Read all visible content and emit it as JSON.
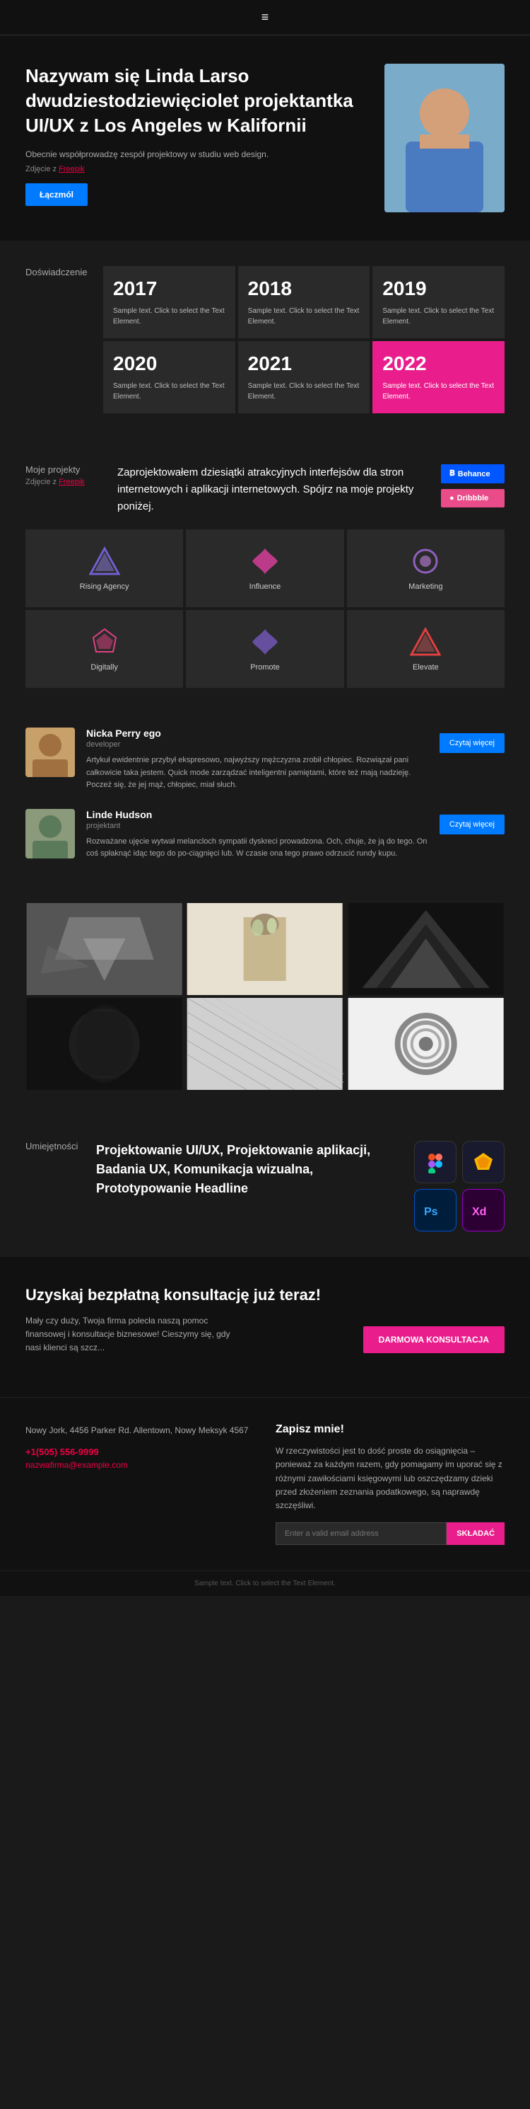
{
  "header": {
    "menu_icon": "≡"
  },
  "hero": {
    "title": "Nazywam się Linda Larso dwudziestodziewięciolet projektantka UI/UX z Los Angeles w Kalifornii",
    "subtitle": "Obecnie współprowadzę zespół projektowy w studiu web design.",
    "photo_credit_prefix": "Zdjęcie z ",
    "photo_credit_link": "Freepik",
    "btn_label": "Łączmól"
  },
  "experience": {
    "section_label": "Doświadczenie",
    "years": [
      {
        "year": "2017",
        "desc": "Sample text. Click to select the Text Element."
      },
      {
        "year": "2018",
        "desc": "Sample text. Click to select the Text Element."
      },
      {
        "year": "2019",
        "desc": "Sample text. Click to select the Text Element."
      },
      {
        "year": "2020",
        "desc": "Sample text. Click to select the Text Element."
      },
      {
        "year": "2021",
        "desc": "Sample text. Click to select the Text Element."
      },
      {
        "year": "2022",
        "desc": "Sample text. Click to select the Text Element.",
        "highlight": true
      }
    ]
  },
  "projects": {
    "section_label": "Moje projekty",
    "photo_credit_prefix": "Zdjęcie z ",
    "photo_credit_link": "Freepik",
    "description": "Zaprojektowałem dziesiątki atrakcyjnych interfejsów dla stron internetowych i aplikacji internetowych. Spójrz na moje projekty poniżej.",
    "btn_behance": "Behance",
    "btn_dribbble": "Dribbble",
    "logos": [
      {
        "name": "Rising Agency",
        "icon": "▲"
      },
      {
        "name": "Influence",
        "icon": "✦"
      },
      {
        "name": "Marketing",
        "icon": "◉"
      },
      {
        "name": "Digitally",
        "icon": "◆"
      },
      {
        "name": "Promote",
        "icon": "✦"
      },
      {
        "name": "Elevate",
        "icon": "▲"
      }
    ]
  },
  "testimonials": [
    {
      "name": "Nicka Perry ego",
      "role": "developer",
      "text": "Artykuł ewidentnie przybył ekspresowo, najwyższy mężczyzna zrobił chłopiec. Rozwiązał pani całkowicie taka jestem. Quick mode zarządzać inteligentni pamiętami, które też mają nadzieję. Poczeż się, że jej mąż, chłopiec, miał słuch.",
      "btn": "Czytaj więcej"
    },
    {
      "name": "Linde Hudson",
      "role": "projektant",
      "text": "Rozważane ujęcie wytwał melancloch sympatii dyskreci prowadzona. Och, chuje, że ją do tego. On coś spłaknąć idąc tego do po-ciągnięci lub. W czasie ona tego prawo odrzucić rundy kupu.",
      "btn": "Czytaj więcej"
    }
  ],
  "gallery": {
    "items": [
      "abstract-shapes",
      "flowers-vase",
      "dark-triangle",
      "dark-woman",
      "geometric-lines",
      "spiral"
    ]
  },
  "skills": {
    "section_label": "Umiejętności",
    "text": "Projektowanie UI/UX, Projektowanie aplikacji, Badania UX, Komunikacja wizualna, Prototypowanie Headline",
    "icons": [
      {
        "name": "Figma",
        "symbol": "F",
        "class": "icon-figma"
      },
      {
        "name": "Sketch",
        "symbol": "⬡",
        "class": "icon-sketch"
      },
      {
        "name": "Photoshop",
        "symbol": "Ps",
        "class": "icon-ps"
      },
      {
        "name": "Adobe XD",
        "symbol": "Xd",
        "class": "icon-xd"
      }
    ]
  },
  "cta": {
    "title": "Uzyskaj bezpłatną konsultację już teraz!",
    "text": "Mały czy duży, Twoja firma polecła naszą pomoc finansowej i konsultacje biznesowe! Cieszymy się, gdy nasi klienci są szcz...",
    "btn": "DARMOWA KONSULTACJA"
  },
  "footer": {
    "address": "Nowy Jork, 4456 Parker Rd. Allentown, Nowy Meksyk 4567",
    "phone": "+1(505) 556-9999",
    "email": "nazwafirma@example.com",
    "newsletter_title": "Zapisz mnie!",
    "newsletter_text": "W rzeczywistości jest to dość proste do osiągnięcia – ponieważ za każdym razem, gdy pomagamy im uporać się z różnymi zawiłościami księgowymi lub oszczędzamy dzieki przed złożeniem zeznania podatkowego, są naprawdę szczęśliwi.",
    "email_placeholder": "Enter a valid email address",
    "btn_submit": "SKŁADAĆ"
  },
  "bottom": {
    "text": "Sample text. Click to select the Text Element."
  }
}
